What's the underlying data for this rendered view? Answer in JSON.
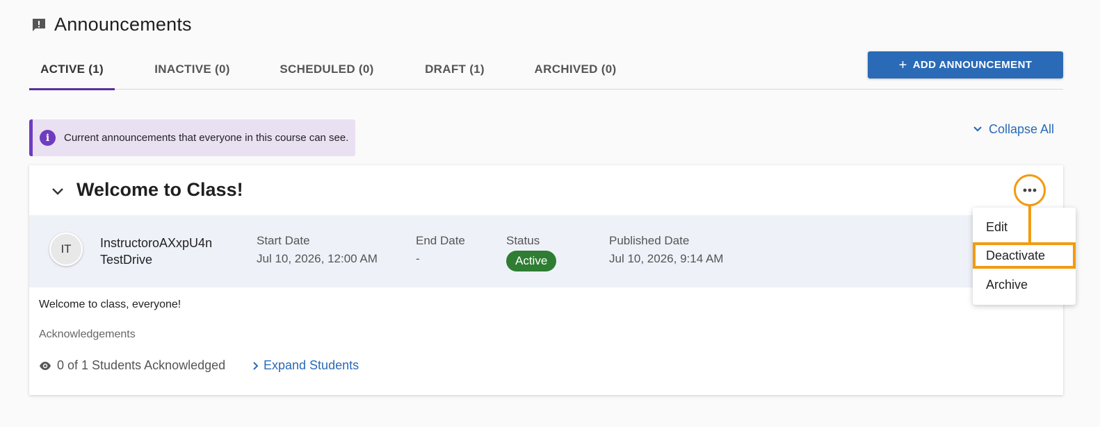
{
  "page": {
    "title": "Announcements",
    "icon": "announcement-icon"
  },
  "tabs": [
    {
      "label": "ACTIVE (1)",
      "active": true
    },
    {
      "label": "INACTIVE (0)",
      "active": false
    },
    {
      "label": "SCHEDULED (0)",
      "active": false
    },
    {
      "label": "DRAFT (1)",
      "active": false
    },
    {
      "label": "ARCHIVED (0)",
      "active": false
    }
  ],
  "add_button": {
    "label": "ADD ANNOUNCEMENT"
  },
  "info_banner": {
    "text": "Current announcements that everyone in this course can see."
  },
  "collapse_all": {
    "label": "Collapse All"
  },
  "announcement": {
    "title": "Welcome to Class!",
    "author": {
      "initials": "IT",
      "name_line1": "InstructoroAXxpU4n",
      "name_line2": "TestDrive"
    },
    "start_date": {
      "label": "Start Date",
      "value": "Jul 10, 2026, 12:00 AM"
    },
    "end_date": {
      "label": "End Date",
      "value": "-"
    },
    "status": {
      "label": "Status",
      "value": "Active"
    },
    "published_date": {
      "label": "Published Date",
      "value": "Jul 10, 2026, 9:14 AM"
    },
    "body": "Welcome to class, everyone!",
    "acknowledgements_label": "Acknowledgements",
    "ack_count": "0 of 1 Students Acknowledged",
    "expand_students": "Expand Students"
  },
  "menu": {
    "items": [
      "Edit",
      "Deactivate",
      "Archive"
    ],
    "highlighted": "Deactivate"
  },
  "colors": {
    "accent": "#2a6ab7",
    "tab_indicator": "#5b2d9e",
    "status_active": "#2e7d32",
    "highlight": "#f29b12",
    "info_bg": "#e9e0f2"
  }
}
